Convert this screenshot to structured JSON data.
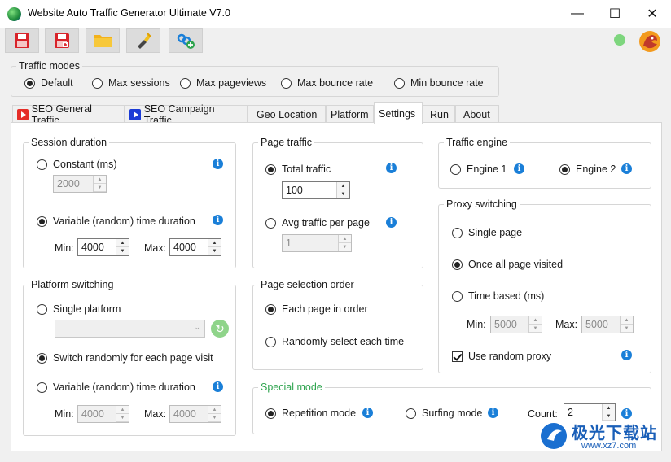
{
  "window": {
    "title": "Website Auto Traffic Generator Ultimate V7.0",
    "controls": {
      "minimize": "—",
      "maximize": "☐",
      "close": "✕"
    }
  },
  "toolbar": {
    "buttons": [
      {
        "name": "save-icon",
        "color": "#d8232a"
      },
      {
        "name": "save-as-icon",
        "color": "#d8232a"
      },
      {
        "name": "open-folder-icon",
        "color": "#f3b11a"
      },
      {
        "name": "flashlight-icon",
        "color": "#f0c020"
      },
      {
        "name": "add-link-icon",
        "color": "#1a7fd8"
      }
    ],
    "status_color": "#7ed67e"
  },
  "traffic_modes": {
    "title": "Traffic modes",
    "options": [
      "Default",
      "Max sessions",
      "Max pageviews",
      "Max bounce rate",
      "Min bounce rate"
    ],
    "selected": "Default"
  },
  "tabs": [
    "SEO General Traffic",
    "SEO Campaign Traffic",
    "Geo Location",
    "Platform",
    "Settings",
    "Run",
    "About"
  ],
  "active_tab": "Settings",
  "session_duration": {
    "title": "Session duration",
    "constant_label": "Constant (ms)",
    "constant_value": "2000",
    "variable_label": "Variable (random) time duration",
    "min_label": "Min:",
    "min_value": "4000",
    "max_label": "Max:",
    "max_value": "4000",
    "selected": "Variable (random) time duration"
  },
  "page_traffic": {
    "title": "Page traffic",
    "total_label": "Total traffic",
    "total_value": "100",
    "avg_label": "Avg traffic per page",
    "avg_value": "1",
    "selected": "Total traffic"
  },
  "traffic_engine": {
    "title": "Traffic engine",
    "engine1": "Engine 1",
    "engine2": "Engine 2",
    "selected": "Engine 2"
  },
  "proxy_switching": {
    "title": "Proxy switching",
    "single": "Single page",
    "once_all": "Once all page visited",
    "time_based": "Time based (ms)",
    "min_label": "Min:",
    "min_value": "5000",
    "max_label": "Max:",
    "max_value": "5000",
    "random_proxy": "Use random proxy",
    "random_proxy_checked": true,
    "selected": "Once all page visited"
  },
  "platform_switching": {
    "title": "Platform switching",
    "single": "Single platform",
    "switch_random": "Switch randomly for each page visit",
    "variable": "Variable (random) time duration",
    "min_label": "Min:",
    "min_value": "4000",
    "max_label": "Max:",
    "max_value": "4000",
    "selected": "Switch randomly for each page visit"
  },
  "page_selection": {
    "title": "Page selection order",
    "in_order": "Each page in order",
    "random": "Randomly select each time",
    "selected": "Each page in order"
  },
  "special_mode": {
    "title": "Special mode",
    "title_color": "#2fa44f",
    "repetition": "Repetition mode",
    "surfing": "Surfing mode",
    "count_label": "Count:",
    "count_value": "2",
    "selected": "Repetition mode"
  },
  "watermark": {
    "text_cn": "极光下载站",
    "url": "www.xz7.com"
  }
}
